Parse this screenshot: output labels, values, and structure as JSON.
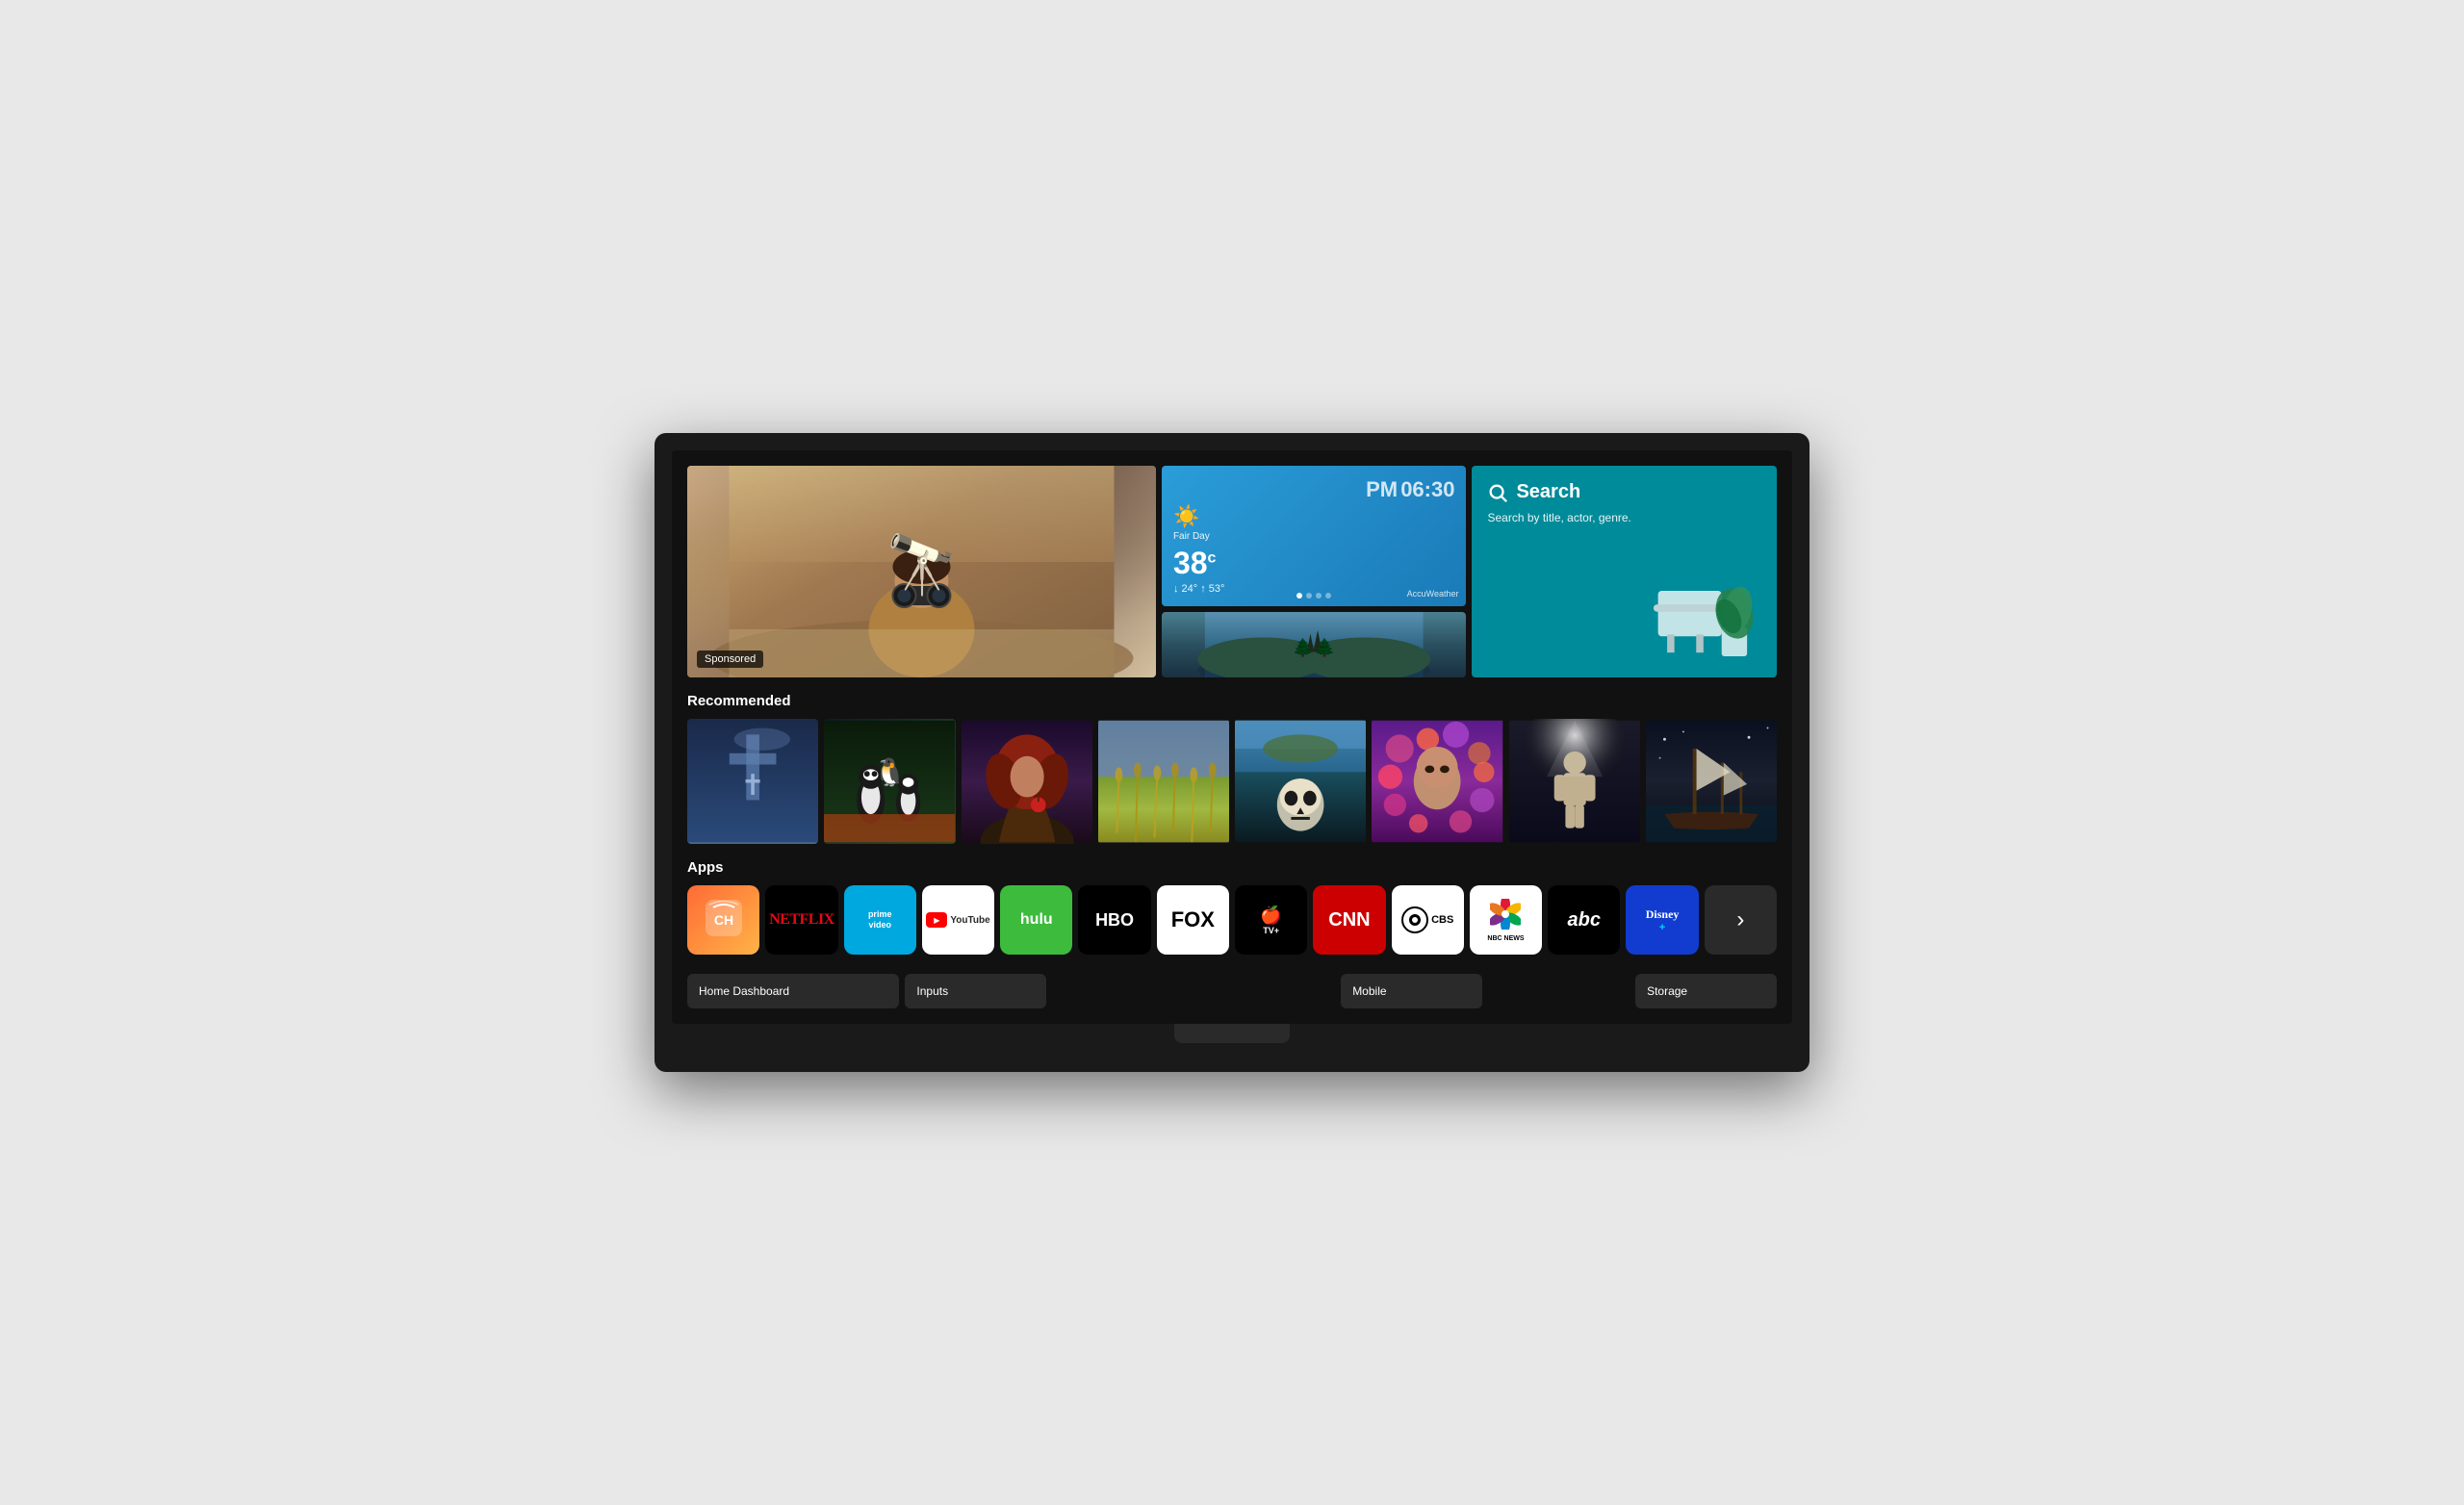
{
  "tv": {
    "hero": {
      "sponsored_label": "Sponsored",
      "weather": {
        "time_period": "PM",
        "time": "06:30",
        "condition": "Fair Day",
        "temp": "38",
        "unit": "c",
        "low": "24°",
        "high": "53°",
        "provider": "AccuWeather"
      },
      "search": {
        "title": "Search",
        "subtitle": "Search by title, actor, genre."
      }
    },
    "sections": {
      "recommended_label": "Recommended",
      "apps_label": "Apps"
    },
    "apps": [
      {
        "id": "ch",
        "label": "CH",
        "type": "ch"
      },
      {
        "id": "netflix",
        "label": "NETFLIX",
        "type": "netflix"
      },
      {
        "id": "prime",
        "label": "prime\nvideo",
        "type": "prime"
      },
      {
        "id": "youtube",
        "label": "YouTube",
        "type": "youtube"
      },
      {
        "id": "hulu",
        "label": "hulu",
        "type": "hulu"
      },
      {
        "id": "hbo",
        "label": "HBO",
        "type": "hbo"
      },
      {
        "id": "fox",
        "label": "FOX",
        "type": "fox"
      },
      {
        "id": "appletv",
        "label": "Apple TV+",
        "type": "appletv"
      },
      {
        "id": "cnn",
        "label": "CNN",
        "type": "cnn"
      },
      {
        "id": "cbs",
        "label": "CBS",
        "type": "cbs"
      },
      {
        "id": "nbc",
        "label": "NBC NEWS",
        "type": "nbc"
      },
      {
        "id": "abc",
        "label": "abc",
        "type": "abc"
      },
      {
        "id": "disney",
        "label": "Disney+",
        "type": "disney"
      },
      {
        "id": "more",
        "label": "›",
        "type": "more"
      }
    ],
    "bottom_nav": [
      {
        "id": "home",
        "label": "Home Dashboard"
      },
      {
        "id": "inputs",
        "label": "Inputs"
      },
      {
        "id": "blank1",
        "label": ""
      },
      {
        "id": "mobile",
        "label": "Mobile"
      },
      {
        "id": "blank2",
        "label": ""
      },
      {
        "id": "storage",
        "label": "Storage"
      }
    ]
  }
}
